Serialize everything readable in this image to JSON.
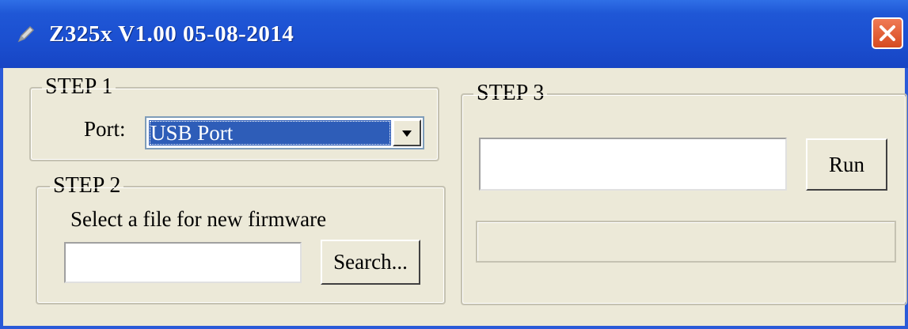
{
  "window": {
    "title": "Z325x V1.00  05-08-2014",
    "icon": "pen-icon"
  },
  "step1": {
    "legend": "STEP 1",
    "port_label": "Port:",
    "port_value": "USB Port"
  },
  "step2": {
    "legend": "STEP 2",
    "instruction": "Select a file for new firmware",
    "file_value": "",
    "search_label": "Search..."
  },
  "step3": {
    "legend": "STEP 3",
    "path_value": "",
    "run_label": "Run",
    "progress": 0
  }
}
